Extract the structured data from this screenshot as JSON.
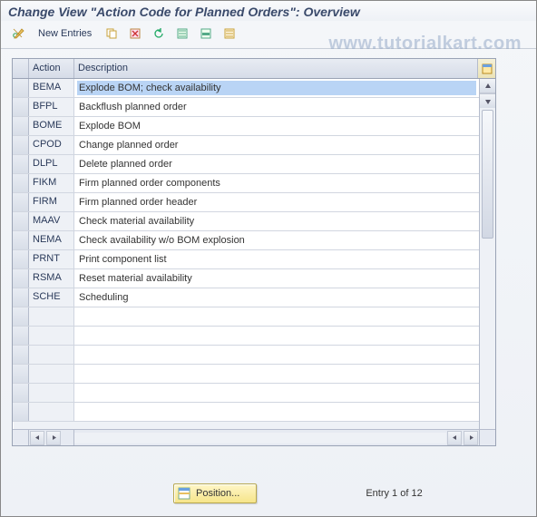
{
  "title": "Change View \"Action Code for Planned Orders\": Overview",
  "watermark": "www.tutorialkart.com",
  "toolbar": {
    "new_entries_label": "New Entries"
  },
  "columns": {
    "action": "Action",
    "description": "Description"
  },
  "rows": [
    {
      "action": "BEMA",
      "description": "Explode BOM; check availability",
      "selected": true
    },
    {
      "action": "BFPL",
      "description": "Backflush planned order"
    },
    {
      "action": "BOME",
      "description": "Explode BOM"
    },
    {
      "action": "CPOD",
      "description": "Change planned order"
    },
    {
      "action": "DLPL",
      "description": "Delete planned order"
    },
    {
      "action": "FIKM",
      "description": "Firm planned order components"
    },
    {
      "action": "FIRM",
      "description": "Firm planned order header"
    },
    {
      "action": "MAAV",
      "description": "Check material availability"
    },
    {
      "action": "NEMA",
      "description": "Check availability w/o BOM explosion"
    },
    {
      "action": "PRNT",
      "description": "Print component list"
    },
    {
      "action": "RSMA",
      "description": "Reset material availability"
    },
    {
      "action": "SCHE",
      "description": "Scheduling"
    }
  ],
  "empty_row_count": 6,
  "footer": {
    "position_label": "Position...",
    "entry_text": "Entry 1 of 12"
  }
}
